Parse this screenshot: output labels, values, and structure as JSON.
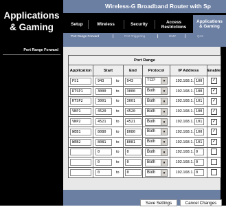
{
  "section_title": [
    "Applications",
    "& Gaming"
  ],
  "product_name": "Wireless-G Broadband Router with Sp",
  "main_tabs": [
    {
      "label": [
        "Setup"
      ],
      "active": false
    },
    {
      "label": [
        "Wireless"
      ],
      "active": false
    },
    {
      "label": [
        "Security"
      ],
      "active": false
    },
    {
      "label": [
        "Access",
        "Restrictions"
      ],
      "active": false
    },
    {
      "label": [
        "Applications",
        "& Gaming"
      ],
      "active": true
    }
  ],
  "sub_tabs": [
    {
      "label": "Port Range Forward",
      "active": true
    },
    {
      "label": "Port Triggering",
      "active": false
    },
    {
      "label": "DMZ",
      "active": false
    },
    {
      "label": "QoS",
      "active": false
    }
  ],
  "left_label": "Port Range Forward",
  "table": {
    "caption": "Port Range",
    "headers": [
      "Application",
      "Start",
      "End",
      "Protocol",
      "IP Address",
      "Enable"
    ],
    "to_label": "to",
    "ip_prefix": "192.168.1.",
    "rows": [
      {
        "app": "PS1",
        "start": "943",
        "end": "943",
        "protocol": "TCP",
        "ip": "100",
        "enabled": true
      },
      {
        "app": "RTSP1",
        "start": "3000",
        "end": "3000",
        "protocol": "Both",
        "ip": "100",
        "enabled": true
      },
      {
        "app": "RTSP2",
        "start": "3001",
        "end": "3001",
        "protocol": "Both",
        "ip": "101",
        "enabled": true
      },
      {
        "app": "VNP1",
        "start": "4520",
        "end": "4520",
        "protocol": "Both",
        "ip": "100",
        "enabled": true
      },
      {
        "app": "VNP2",
        "start": "4521",
        "end": "4521",
        "protocol": "Both",
        "ip": "101",
        "enabled": true
      },
      {
        "app": "WEB1",
        "start": "8080",
        "end": "8080",
        "protocol": "Both",
        "ip": "100",
        "enabled": true
      },
      {
        "app": "WEB2",
        "start": "8081",
        "end": "8081",
        "protocol": "Both",
        "ip": "101",
        "enabled": true
      },
      {
        "app": "",
        "start": "0",
        "end": "0",
        "protocol": "Both",
        "ip": "0",
        "enabled": false
      },
      {
        "app": "",
        "start": "0",
        "end": "0",
        "protocol": "Both",
        "ip": "0",
        "enabled": false
      },
      {
        "app": "",
        "start": "0",
        "end": "0",
        "protocol": "Both",
        "ip": "0",
        "enabled": false
      }
    ]
  },
  "buttons": {
    "save": "Save Settings",
    "cancel": "Cancel Changes"
  },
  "colors": {
    "accent": "#6b7fa3",
    "background": "#000000"
  },
  "icons": {
    "dropdown": "chevron-down-icon",
    "checkbox_checked": "checkmark-icon"
  }
}
